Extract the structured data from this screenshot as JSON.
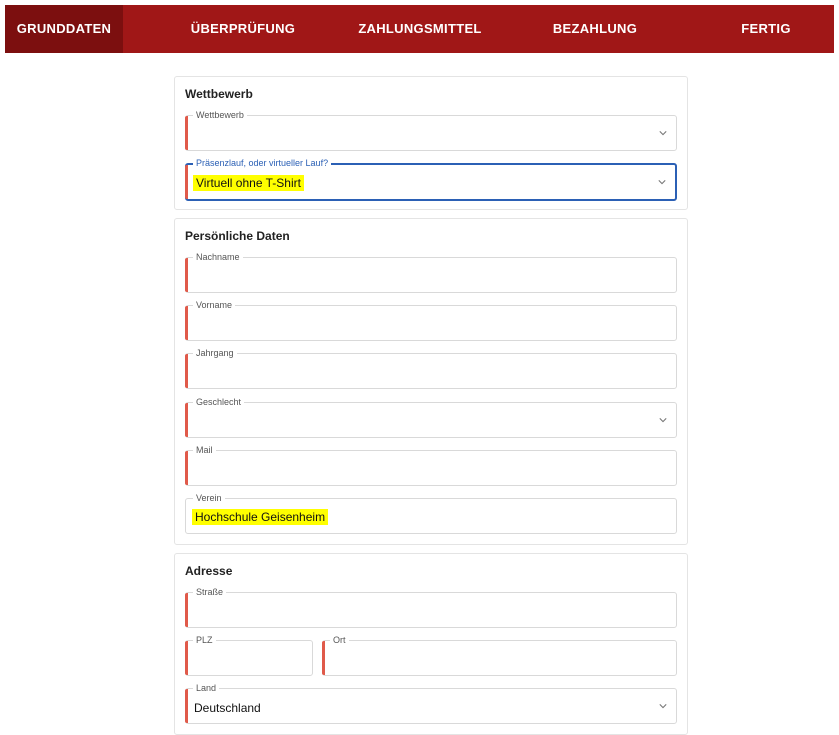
{
  "steps": [
    {
      "label": "GRUNDDATEN",
      "active": true
    },
    {
      "label": "ÜBERPRÜFUNG",
      "active": false
    },
    {
      "label": "ZAHLUNGSMITTEL",
      "active": false
    },
    {
      "label": "BEZAHLUNG",
      "active": false
    },
    {
      "label": "FERTIG",
      "active": false
    }
  ],
  "colors": {
    "navbar": "#a01717",
    "navbar_active": "#7c0f0f",
    "required_marker": "#e05a4a",
    "focus_border": "#2b60b5",
    "highlight": "#ffff00"
  },
  "wettbewerb": {
    "title": "Wettbewerb",
    "competition_label": "Wettbewerb",
    "competition_value": "",
    "mode_label": "Präsenzlauf, oder virtueller Lauf?",
    "mode_value": "Virtuell ohne T-Shirt"
  },
  "personal": {
    "title": "Persönliche Daten",
    "nachname_label": "Nachname",
    "vorname_label": "Vorname",
    "jahrgang_label": "Jahrgang",
    "geschlecht_label": "Geschlecht",
    "mail_label": "Mail",
    "verein_label": "Verein",
    "verein_value": "Hochschule Geisenheim"
  },
  "address": {
    "title": "Adresse",
    "strasse_label": "Straße",
    "plz_label": "PLZ",
    "ort_label": "Ort",
    "land_label": "Land",
    "land_value": "Deutschland"
  },
  "icons": {
    "dropdown": "chevron-down-icon"
  }
}
